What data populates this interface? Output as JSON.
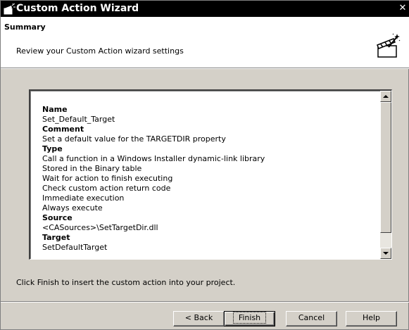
{
  "window": {
    "title": "Custom Action Wizard",
    "close_glyph": "✕"
  },
  "header": {
    "title": "Summary",
    "subtitle": "Review your Custom Action wizard settings",
    "icon": "clapperboard-wand-icon"
  },
  "summary": {
    "rows": [
      {
        "text": "Name",
        "bold": true
      },
      {
        "text": "Set_Default_Target",
        "bold": false
      },
      {
        "text": "Comment",
        "bold": true
      },
      {
        "text": "Set a default value for the TARGETDIR property",
        "bold": false
      },
      {
        "text": "Type",
        "bold": true
      },
      {
        "text": "Call a function in a Windows Installer dynamic-link library",
        "bold": false
      },
      {
        "text": "Stored in the Binary table",
        "bold": false
      },
      {
        "text": "Wait for action to finish executing",
        "bold": false
      },
      {
        "text": "Check custom action return code",
        "bold": false
      },
      {
        "text": "Immediate execution",
        "bold": false
      },
      {
        "text": "Always execute",
        "bold": false
      },
      {
        "text": "Source",
        "bold": true
      },
      {
        "text": "<CASources>\\SetTargetDir.dll",
        "bold": false
      },
      {
        "text": "Target",
        "bold": true
      },
      {
        "text": "SetDefaultTarget",
        "bold": false
      }
    ]
  },
  "footer": {
    "instruction": "Click Finish to insert the custom action into your project."
  },
  "buttons": {
    "back": "< Back",
    "finish": "Finish",
    "cancel": "Cancel",
    "help": "Help"
  }
}
